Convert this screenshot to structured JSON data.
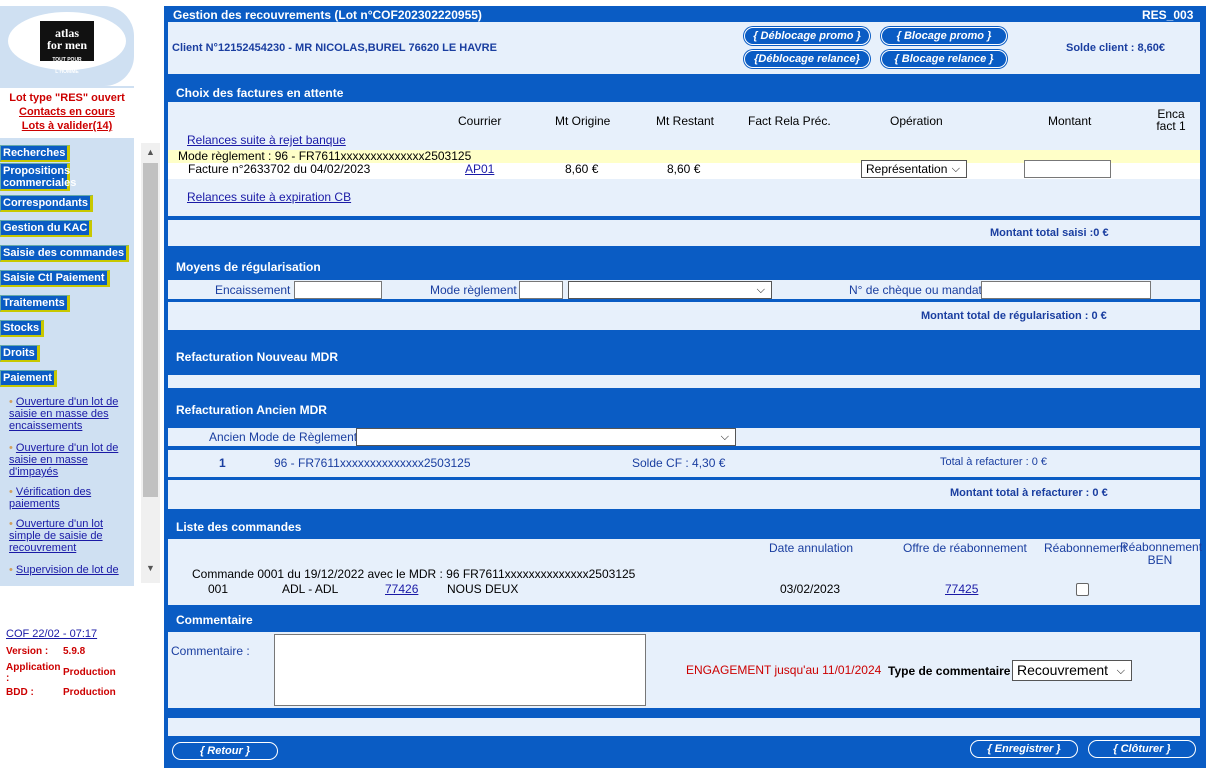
{
  "sidebar": {
    "logo_text1": "atlas",
    "logo_text2": "for men",
    "logo_sub": "TOUT POUR L'HOMME",
    "lot_type": "Lot type \"RES\" ouvert",
    "contacts": "Contacts en cours",
    "lots": "Lots à valider(14)",
    "menu": [
      "Recherches",
      "Propositions commerciales",
      "Correspondants",
      "Gestion du KAC",
      "Saisie des commandes",
      "Saisie Ctl Paiement",
      "Traitements",
      "Stocks",
      "Droits",
      "Paiement"
    ],
    "subs": [
      "Ouverture d'un lot de saisie en masse des encaissements",
      "Ouverture d'un lot de saisie en masse d'impayés",
      "Vérification des paiements",
      "Ouverture d'un lot simple de saisie de recouvrement",
      "Supervision de lot de"
    ],
    "cof": "COF 22/02 - 07:17",
    "version_label": "Version :",
    "version": "5.9.8",
    "app_label": "Application :",
    "app": "Production",
    "bdd_label": "BDD :",
    "bdd": "Production"
  },
  "header": {
    "title": "Gestion des recouvrements (Lot n°COF202302220955)",
    "code": "RES_003",
    "client": "Client N°12152454230 - MR NICOLAS,BUREL 76620 LE HAVRE",
    "btn_deb_promo": "{ Déblocage promo }",
    "btn_bloc_promo": "{ Blocage promo }",
    "btn_deb_rel": "{Déblocage relance}",
    "btn_bloc_rel": "{ Blocage relance }",
    "solde": "Solde client : 8,60€"
  },
  "factures": {
    "title": "Choix des factures en attente",
    "cols": [
      "Courrier",
      "Mt Origine",
      "Mt Restant",
      "Fact Rela Préc.",
      "Opération",
      "Montant",
      "Enca fact 1"
    ],
    "link_rejet": "Relances suite à rejet banque",
    "mode": "Mode règlement : 96 - FR7611xxxxxxxxxxxxxx2503125",
    "facture": "Facture n°2633702 du 04/02/2023",
    "courrier": "AP01",
    "mt_origine": "8,60 €",
    "mt_restant": "8,60 €",
    "operation": "Représentation",
    "link_cb": "Relances suite à expiration CB",
    "total": "Montant total saisi :0 €"
  },
  "regul": {
    "title": "Moyens de régularisation",
    "enc": "Encaissement :",
    "mode": "Mode règlement :",
    "cheque": "N° de chèque ou mandat :",
    "total": "Montant total de régularisation : 0 €"
  },
  "refnew": {
    "title": "Refacturation Nouveau MDR"
  },
  "refold": {
    "title": "Refacturation Ancien MDR",
    "ancien": "Ancien Mode de Règlement :",
    "num": "1",
    "mdr": "96 - FR7611xxxxxxxxxxxxxx2503125",
    "solde": "Solde CF : 4,30 €",
    "total_ref": "Total à refacturer : 0 €",
    "montant_total": "Montant total à refacturer : 0 €"
  },
  "commandes": {
    "title": "Liste des commandes",
    "col_date": "Date annulation",
    "col_offre": "Offre de réabonnement",
    "col_reab": "Réabonnement",
    "col_reab_ben": "Réabonnement BEN",
    "cmd": "Commande 0001 du 19/12/2022 avec le MDR : 96 FR7611xxxxxxxxxxxxxx2503125",
    "r_num": "001",
    "r_adl": "ADL - ADL",
    "r_code": "77426",
    "r_titre": "NOUS DEUX",
    "r_date": "03/02/2023",
    "r_offre": "77425"
  },
  "commentaire": {
    "title": "Commentaire",
    "label": "Commentaire :",
    "engagement": "ENGAGEMENT jusqu'au 11/01/2024",
    "type_label": "Type de commentaire :",
    "type": "Recouvrement"
  },
  "footer": {
    "retour": "{ Retour }",
    "enregistrer": "{ Enregistrer }",
    "cloturer": "{ Clôturer }"
  }
}
